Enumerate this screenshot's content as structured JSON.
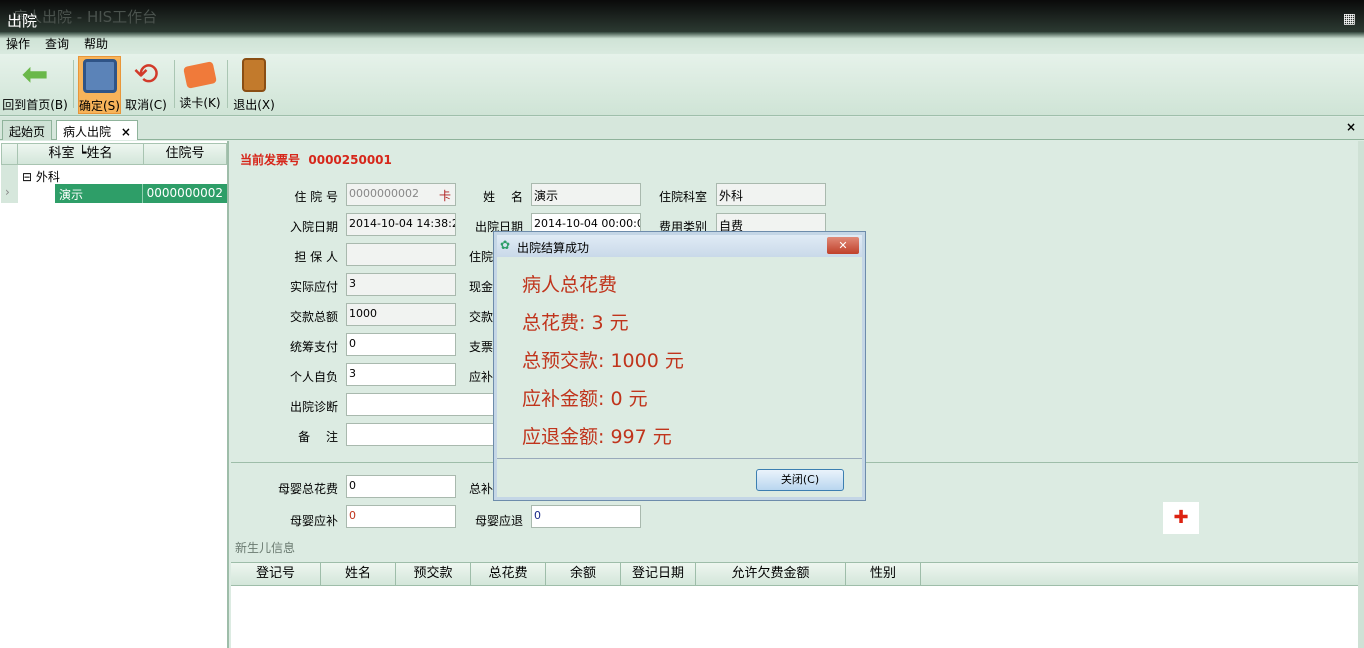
{
  "window": {
    "title": "出院",
    "bg_title": "病人出院 - HIS工作台"
  },
  "menu": [
    "操作",
    "查询",
    "帮助"
  ],
  "toolbar": {
    "home": "回到首页(B)",
    "confirm": "确定(S)",
    "cancel": "取消(C)",
    "read_card": "读卡(K)",
    "exit": "退出(X)"
  },
  "tabs": {
    "start": "起始页",
    "discharge": "病人出院",
    "close": "×"
  },
  "left_grid": {
    "col1": "科室 ┕姓名",
    "col2": "住院号",
    "dept": "外科",
    "patient": "演示",
    "patient_id": "0000000002",
    "expander": "⊟",
    "row_pointer": "›"
  },
  "form": {
    "invoice_label": "当前发票号",
    "invoice_no": "0000250001",
    "inpatient_no_label": "住 院 号",
    "inpatient_no": "0000000002",
    "card_btn": "卡",
    "name_label": "姓　 名",
    "name": "演示",
    "dept_label": "住院科室",
    "dept": "外科",
    "admit_label": "入院日期",
    "admit": "2014-10-04 14:38:2",
    "discharge_label": "出院日期",
    "discharge": "2014-10-04 00:00:0",
    "fee_type_label": "费用类别",
    "fee_type": "自费",
    "guarantor_label": "担 保 人",
    "guarantor": "",
    "actual_label": "实际应付",
    "actual": "3",
    "deposit_label": "交款总额",
    "deposit": "1000",
    "pooled_label": "统筹支付",
    "pooled": "0",
    "self_label": "个人自负",
    "self": "3",
    "diag_label": "出院诊断",
    "diag": "",
    "note_label": "备　 注",
    "note": "",
    "hidden_labels": [
      "住院",
      "现金",
      "交款",
      "支票",
      "应补"
    ],
    "mb_total_label": "母婴总花费",
    "mb_total": "0",
    "mb_total2_label": "总补",
    "mb_supp_label": "母婴应补",
    "mb_supp": "0",
    "mb_refund_label": "母婴应退",
    "mb_refund": "0"
  },
  "newborn": {
    "title": "新生儿信息",
    "columns": [
      "登记号",
      "姓名",
      "预交款",
      "总花费",
      "余额",
      "登记日期",
      "允许欠费金额",
      "性别"
    ]
  },
  "dialog": {
    "title": "出院结算成功",
    "close": "✕",
    "heading": "病人总花费",
    "total": "总花费: 3 元",
    "prepaid": "总预交款: 1000 元",
    "supplement": "应补金额: 0 元",
    "refund": "应退金额: 997 元",
    "close_btn": "关闭(C)"
  },
  "colors": {
    "accent": "#2e9e68",
    "red": "#c0341c"
  }
}
